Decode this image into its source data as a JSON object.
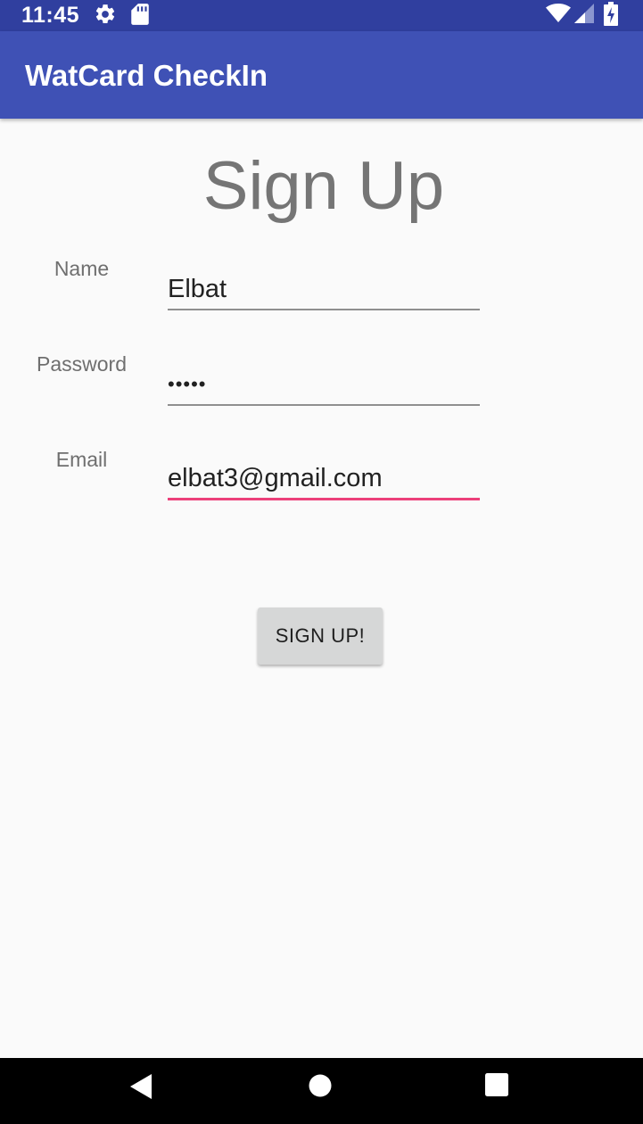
{
  "status_bar": {
    "time": "11:45",
    "icons": [
      "gear-icon",
      "sd-card-icon",
      "wifi-icon",
      "cell-signal-icon",
      "battery-charging-icon"
    ]
  },
  "app_bar": {
    "title": "WatCard CheckIn"
  },
  "form": {
    "title": "Sign Up",
    "fields": [
      {
        "label": "Name",
        "value": "Elbat"
      },
      {
        "label": "Password",
        "value": "•••••"
      },
      {
        "label": "Email",
        "value": "elbat3@gmail.com"
      }
    ],
    "submit_label": "SIGN UP!"
  },
  "nav_bar": {
    "icons": [
      "back-icon",
      "home-icon",
      "recents-icon"
    ]
  },
  "colors": {
    "status_bar": "#303f9f",
    "app_bar": "#3f51b5",
    "focus_accent": "#ec407a",
    "background": "#fafafa"
  }
}
